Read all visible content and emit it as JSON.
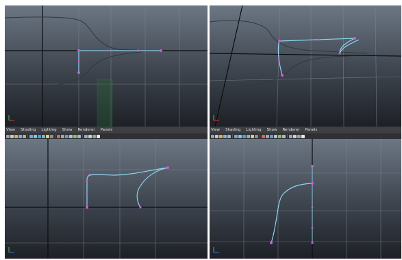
{
  "menu_panels": [
    {
      "items": [
        "View",
        "Shading",
        "Lighting",
        "Show",
        "Renderer",
        "Panels"
      ]
    },
    {
      "items": [
        "View",
        "Shading",
        "Lighting",
        "Show",
        "Renderer",
        "Panels"
      ]
    }
  ],
  "toolbar_icons": [
    "camera-icon",
    "select-icon",
    "lock-icon",
    "bookmark-icon",
    "gear-icon",
    "grid-icon",
    "wireframe-icon",
    "smooth-shade-icon",
    "texture-icon",
    "light-icon",
    "shadow-icon",
    "isolate-icon",
    "xray-icon",
    "resolution-icon",
    "gate-icon",
    "safe-action-icon",
    "field-chart-icon",
    "film-icon",
    "camera-settings-icon",
    "ortho-icon",
    "grease-pencil-icon"
  ],
  "colors": {
    "viewport_top": "#6c7784",
    "viewport_bottom": "#1d2026",
    "curve": "#8ed6f0",
    "cv_point": "#d05ad8",
    "grid": "#7e8896",
    "axis_line": "#0c0c0e",
    "ghost_curve": "#2e3a3c"
  }
}
